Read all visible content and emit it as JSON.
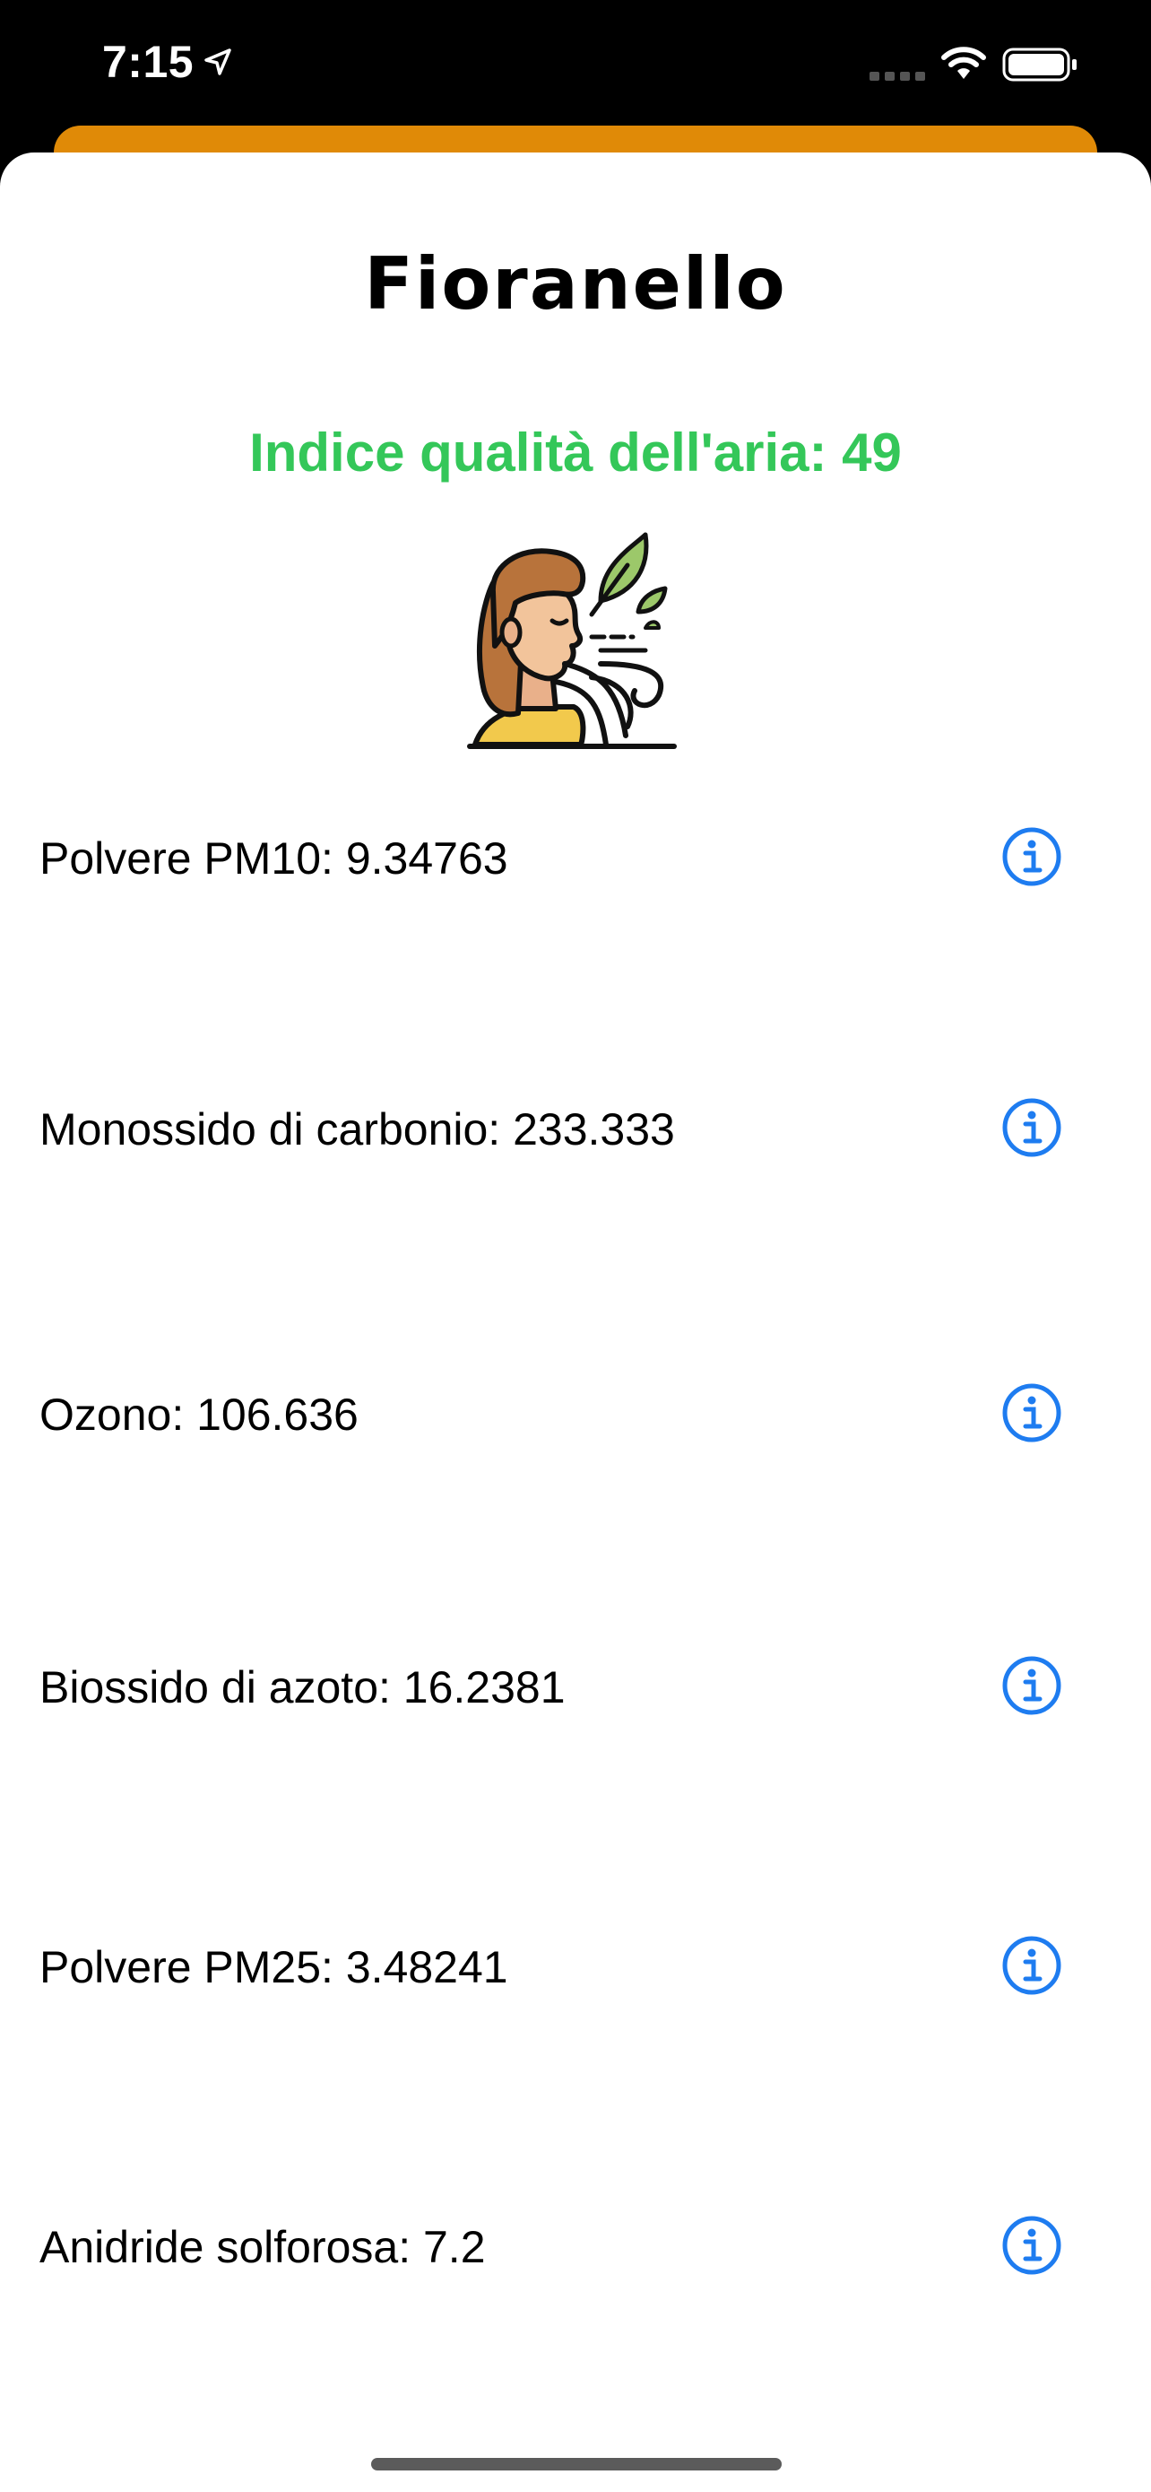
{
  "status_bar": {
    "time": "7:15",
    "icons": [
      "location-arrow-icon",
      "cellular-signal-icon",
      "wifi-icon",
      "battery-icon"
    ]
  },
  "header": {
    "city": "Fioranello",
    "aqi_label": "Indice qualità dell'aria: 49",
    "aqi_color": "#34C759",
    "illustration": "person-breathing-fresh-air-icon"
  },
  "pollutants": [
    {
      "label": "Polvere PM10: 9.34763",
      "icon": "info-icon"
    },
    {
      "label": "Monossido di carbonio: 233.333",
      "icon": "info-icon"
    },
    {
      "label": "Ozono: 106.636",
      "icon": "info-icon"
    },
    {
      "label": "Biossido di azoto: 16.2381",
      "icon": "info-icon"
    },
    {
      "label": "Polvere PM25: 3.48241",
      "icon": "info-icon"
    },
    {
      "label": "Anidride solforosa: 7.2",
      "icon": "info-icon"
    }
  ],
  "colors": {
    "accent_orange": "#E08A07",
    "info_blue": "#1E7CF0"
  }
}
